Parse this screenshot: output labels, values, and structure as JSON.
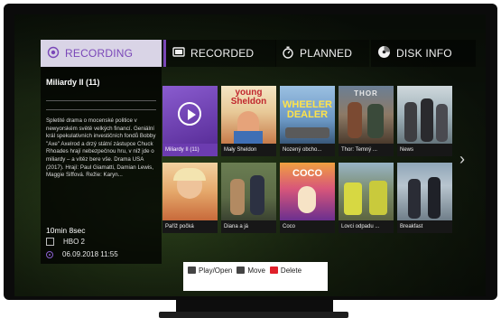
{
  "tabs": [
    {
      "label": "RECORDING",
      "icon": "record-icon",
      "active": true
    },
    {
      "label": "RECORDED",
      "icon": "tv-icon",
      "active": false
    },
    {
      "label": "PLANNED",
      "icon": "stopwatch-icon",
      "active": false
    },
    {
      "label": "DISK INFO",
      "icon": "disk-icon",
      "active": false
    }
  ],
  "info": {
    "title": "Miliardy II (11)",
    "description": "Spletité drama o mocenské politice v newyorském světě velkých financí. Geniální král spekulativních investičních fondů Bobby \"Axe\" Axelrod a drzý státní zástupce Chuck Rhoades hrají nebezpečnou hru, v níž jde o miliardy – a vítěz bere vše. Drama USA (2017). Hrají: Paul Giamatti, Damian Lewis, Maggie Siffová. Režie: Karyn...",
    "duration": "10min 8sec",
    "channel": "HBO 2",
    "datetime": "06.09.2018 11:55"
  },
  "tiles": [
    {
      "caption": "Miliardy II (11)",
      "selected": true
    },
    {
      "caption": "Mały Sheldon",
      "poster_text": "young Sheldon"
    },
    {
      "caption": "Nozený obcho...",
      "poster_text": "WHEELER DEALER"
    },
    {
      "caption": "Thor: Temný ...",
      "poster_text": "THOR"
    },
    {
      "caption": "News"
    },
    {
      "caption": "Paříž počká"
    },
    {
      "caption": "Diana a já"
    },
    {
      "caption": "Coco",
      "poster_text": "COCO"
    },
    {
      "caption": "Lovci odpadu ..."
    },
    {
      "caption": "Breakfast"
    }
  ],
  "hints": [
    {
      "label": "Play/Open",
      "key": "ok-key-icon"
    },
    {
      "label": "Move",
      "key": "move-key-icon"
    },
    {
      "label": "Delete",
      "key": "red-key-icon",
      "color": "#e0202a"
    }
  ],
  "colors": {
    "accent": "#7a47b8",
    "delete": "#e0202a"
  }
}
